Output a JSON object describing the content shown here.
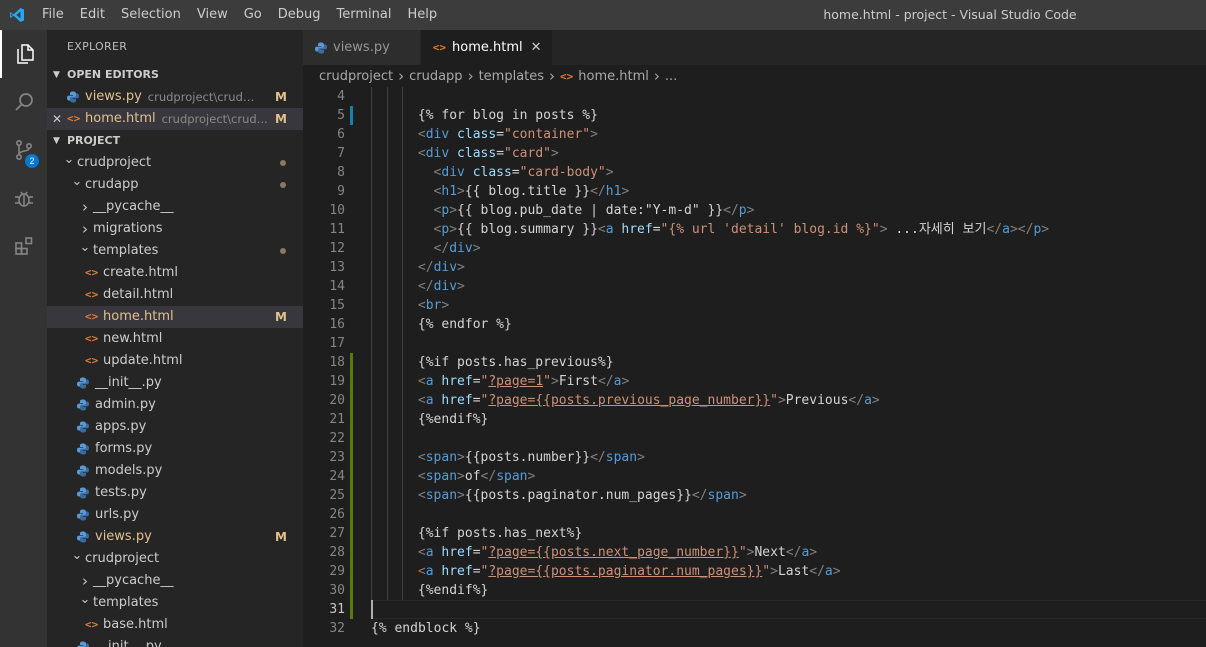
{
  "window": {
    "title": "home.html - project - Visual Studio Code"
  },
  "menu": [
    "File",
    "Edit",
    "Selection",
    "View",
    "Go",
    "Debug",
    "Terminal",
    "Help"
  ],
  "activity": {
    "scm_badge": "2"
  },
  "sidebar": {
    "title": "EXPLORER",
    "open_editors": {
      "header": "OPEN EDITORS",
      "items": [
        {
          "name": "views.py",
          "dir": "crudproject\\crudapp",
          "status": "M"
        },
        {
          "name": "home.html",
          "dir": "crudproject\\crud...",
          "status": "M"
        }
      ]
    },
    "project": {
      "header": "PROJECT",
      "tree": [
        {
          "name": "crudproject",
          "type": "folder-open"
        },
        {
          "name": "crudapp",
          "type": "folder-open"
        },
        {
          "name": "__pycache__",
          "type": "folder"
        },
        {
          "name": "migrations",
          "type": "folder"
        },
        {
          "name": "templates",
          "type": "folder-open"
        },
        {
          "name": "create.html",
          "type": "html"
        },
        {
          "name": "detail.html",
          "type": "html"
        },
        {
          "name": "home.html",
          "type": "html",
          "status": "M"
        },
        {
          "name": "new.html",
          "type": "html"
        },
        {
          "name": "update.html",
          "type": "html"
        },
        {
          "name": "__init__.py",
          "type": "py"
        },
        {
          "name": "admin.py",
          "type": "py"
        },
        {
          "name": "apps.py",
          "type": "py"
        },
        {
          "name": "forms.py",
          "type": "py"
        },
        {
          "name": "models.py",
          "type": "py"
        },
        {
          "name": "tests.py",
          "type": "py"
        },
        {
          "name": "urls.py",
          "type": "py"
        },
        {
          "name": "views.py",
          "type": "py",
          "status": "M"
        },
        {
          "name": "crudproject",
          "type": "folder-open"
        },
        {
          "name": "__pycache__",
          "type": "folder"
        },
        {
          "name": "templates",
          "type": "folder-open"
        },
        {
          "name": "base.html",
          "type": "html"
        },
        {
          "name": "__init__.py",
          "type": "py"
        }
      ]
    }
  },
  "tabs": [
    {
      "label": "views.py",
      "close": ""
    },
    {
      "label": "home.html",
      "close": "✕"
    }
  ],
  "breadcrumb": [
    "crudproject",
    "crudapp",
    "templates",
    "home.html",
    "..."
  ],
  "editor": {
    "lines": [
      {
        "n": "4",
        "t": []
      },
      {
        "n": "5",
        "t": [
          [
            "txt",
            "{% for blog in posts %}"
          ]
        ]
      },
      {
        "n": "6",
        "t": [
          [
            "ang",
            "<"
          ],
          [
            "tag",
            "div"
          ],
          [
            "txt",
            " "
          ],
          [
            "attr",
            "class"
          ],
          [
            "txt",
            "="
          ],
          [
            "str",
            "\"container\""
          ],
          [
            "ang",
            ">"
          ]
        ]
      },
      {
        "n": "7",
        "t": [
          [
            "ang",
            "<"
          ],
          [
            "tag",
            "div"
          ],
          [
            "txt",
            " "
          ],
          [
            "attr",
            "class"
          ],
          [
            "txt",
            "="
          ],
          [
            "str",
            "\"card\""
          ],
          [
            "ang",
            ">"
          ]
        ]
      },
      {
        "n": "8",
        "t": [
          [
            "ang",
            "<"
          ],
          [
            "tag",
            "div"
          ],
          [
            "txt",
            " "
          ],
          [
            "attr",
            "class"
          ],
          [
            "txt",
            "="
          ],
          [
            "str",
            "\"card-body\""
          ],
          [
            "ang",
            ">"
          ]
        ]
      },
      {
        "n": "9",
        "t": [
          [
            "ang",
            "<"
          ],
          [
            "tag",
            "h1"
          ],
          [
            "ang",
            ">"
          ],
          [
            "txt",
            "{{ blog.title }}"
          ],
          [
            "ang",
            "</"
          ],
          [
            "tag",
            "h1"
          ],
          [
            "ang",
            ">"
          ]
        ]
      },
      {
        "n": "10",
        "t": [
          [
            "ang",
            "<"
          ],
          [
            "tag",
            "p"
          ],
          [
            "ang",
            ">"
          ],
          [
            "txt",
            "{{ blog.pub_date | date:\"Y-m-d\" }}"
          ],
          [
            "ang",
            "</"
          ],
          [
            "tag",
            "p"
          ],
          [
            "ang",
            ">"
          ]
        ]
      },
      {
        "n": "11",
        "t": [
          [
            "ang",
            "<"
          ],
          [
            "tag",
            "p"
          ],
          [
            "ang",
            ">"
          ],
          [
            "txt",
            "{{ blog.summary }}"
          ],
          [
            "ang",
            "<"
          ],
          [
            "tag",
            "a"
          ],
          [
            "txt",
            " "
          ],
          [
            "attr",
            "href"
          ],
          [
            "txt",
            "="
          ],
          [
            "str",
            "\"{% url 'detail' blog.id %}\""
          ],
          [
            "ang",
            ">"
          ],
          [
            "txt",
            " ...자세히 보기"
          ],
          [
            "ang",
            "</"
          ],
          [
            "tag",
            "a"
          ],
          [
            "ang",
            "></"
          ],
          [
            "tag",
            "p"
          ],
          [
            "ang",
            ">"
          ]
        ]
      },
      {
        "n": "12",
        "t": [
          [
            "ang",
            "</"
          ],
          [
            "tag",
            "div"
          ],
          [
            "ang",
            ">"
          ]
        ]
      },
      {
        "n": "13",
        "t": [
          [
            "ang",
            "</"
          ],
          [
            "tag",
            "div"
          ],
          [
            "ang",
            ">"
          ]
        ]
      },
      {
        "n": "14",
        "t": [
          [
            "ang",
            "</"
          ],
          [
            "tag",
            "div"
          ],
          [
            "ang",
            ">"
          ]
        ]
      },
      {
        "n": "15",
        "t": [
          [
            "ang",
            "<"
          ],
          [
            "tag",
            "br"
          ],
          [
            "ang",
            ">"
          ]
        ]
      },
      {
        "n": "16",
        "t": [
          [
            "txt",
            "{% endfor %}"
          ]
        ]
      },
      {
        "n": "17",
        "t": []
      },
      {
        "n": "18",
        "t": [
          [
            "txt",
            "{%if posts.has_previous%}"
          ]
        ]
      },
      {
        "n": "19",
        "t": [
          [
            "ang",
            "<"
          ],
          [
            "tag",
            "a"
          ],
          [
            "txt",
            " "
          ],
          [
            "attr",
            "href"
          ],
          [
            "txt",
            "="
          ],
          [
            "str",
            "\""
          ],
          [
            "url",
            "?page=1"
          ],
          [
            "str",
            "\""
          ],
          [
            "ang",
            ">"
          ],
          [
            "txt",
            "First"
          ],
          [
            "ang",
            "</"
          ],
          [
            "tag",
            "a"
          ],
          [
            "ang",
            ">"
          ]
        ]
      },
      {
        "n": "20",
        "t": [
          [
            "ang",
            "<"
          ],
          [
            "tag",
            "a"
          ],
          [
            "txt",
            " "
          ],
          [
            "attr",
            "href"
          ],
          [
            "txt",
            "="
          ],
          [
            "str",
            "\""
          ],
          [
            "url",
            "?page={{posts.previous_page_number}}"
          ],
          [
            "str",
            "\""
          ],
          [
            "ang",
            ">"
          ],
          [
            "txt",
            "Previous"
          ],
          [
            "ang",
            "</"
          ],
          [
            "tag",
            "a"
          ],
          [
            "ang",
            ">"
          ]
        ]
      },
      {
        "n": "21",
        "t": [
          [
            "txt",
            "{%endif%}"
          ]
        ]
      },
      {
        "n": "22",
        "t": []
      },
      {
        "n": "23",
        "t": [
          [
            "ang",
            "<"
          ],
          [
            "tag",
            "span"
          ],
          [
            "ang",
            ">"
          ],
          [
            "txt",
            "{{posts.number}}"
          ],
          [
            "ang",
            "</"
          ],
          [
            "tag",
            "span"
          ],
          [
            "ang",
            ">"
          ]
        ]
      },
      {
        "n": "24",
        "t": [
          [
            "ang",
            "<"
          ],
          [
            "tag",
            "span"
          ],
          [
            "ang",
            ">"
          ],
          [
            "txt",
            "of"
          ],
          [
            "ang",
            "</"
          ],
          [
            "tag",
            "span"
          ],
          [
            "ang",
            ">"
          ]
        ]
      },
      {
        "n": "25",
        "t": [
          [
            "ang",
            "<"
          ],
          [
            "tag",
            "span"
          ],
          [
            "ang",
            ">"
          ],
          [
            "txt",
            "{{posts.paginator.num_pages}}"
          ],
          [
            "ang",
            "</"
          ],
          [
            "tag",
            "span"
          ],
          [
            "ang",
            ">"
          ]
        ]
      },
      {
        "n": "26",
        "t": []
      },
      {
        "n": "27",
        "t": [
          [
            "txt",
            "{%if posts.has_next%}"
          ]
        ]
      },
      {
        "n": "28",
        "t": [
          [
            "ang",
            "<"
          ],
          [
            "tag",
            "a"
          ],
          [
            "txt",
            " "
          ],
          [
            "attr",
            "href"
          ],
          [
            "txt",
            "="
          ],
          [
            "str",
            "\""
          ],
          [
            "url",
            "?page={{posts.next_page_number}}"
          ],
          [
            "str",
            "\""
          ],
          [
            "ang",
            ">"
          ],
          [
            "txt",
            "Next"
          ],
          [
            "ang",
            "</"
          ],
          [
            "tag",
            "a"
          ],
          [
            "ang",
            ">"
          ]
        ]
      },
      {
        "n": "29",
        "t": [
          [
            "ang",
            "<"
          ],
          [
            "tag",
            "a"
          ],
          [
            "txt",
            " "
          ],
          [
            "attr",
            "href"
          ],
          [
            "txt",
            "="
          ],
          [
            "str",
            "\""
          ],
          [
            "url",
            "?page={{posts.paginator.num_pages}}"
          ],
          [
            "str",
            "\""
          ],
          [
            "ang",
            ">"
          ],
          [
            "txt",
            "Last"
          ],
          [
            "ang",
            "</"
          ],
          [
            "tag",
            "a"
          ],
          [
            "ang",
            ">"
          ]
        ]
      },
      {
        "n": "30",
        "t": [
          [
            "txt",
            "{%endif%}"
          ]
        ]
      },
      {
        "n": "31",
        "t": []
      },
      {
        "n": "32",
        "t": [
          [
            "txt",
            "{% endblock %}"
          ]
        ]
      }
    ]
  },
  "colors": {
    "gutter_modified": "#1b81a8",
    "gutter_added": "#587c0c",
    "modified_label": "#e2c08d",
    "accent": "#007acc"
  }
}
